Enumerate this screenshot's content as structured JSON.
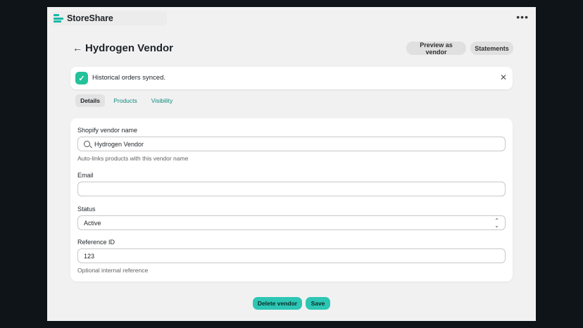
{
  "app": {
    "name": "StoreShare",
    "more_label": "•••"
  },
  "header": {
    "back_label": "←",
    "title": "Hydrogen Vendor",
    "preview_label": "Preview as vendor",
    "statements_label": "Statements"
  },
  "banner": {
    "check_glyph": "✓",
    "message": "Historical orders synced.",
    "close_glyph": "✕"
  },
  "tabs": [
    {
      "label": "Details",
      "selected": true
    },
    {
      "label": "Products",
      "selected": false
    },
    {
      "label": "Visibility",
      "selected": false
    }
  ],
  "form": {
    "vendor_name": {
      "label": "Shopify vendor name",
      "value": "Hydrogen Vendor",
      "help": "Auto-links products with this vendor name"
    },
    "email": {
      "label": "Email",
      "value": ""
    },
    "status": {
      "label": "Status",
      "value": "Active"
    },
    "reference": {
      "label": "Reference ID",
      "value": "123",
      "help": "Optional internal reference"
    }
  },
  "footer": {
    "delete_label": "Delete vendor",
    "save_label": "Save"
  },
  "colors": {
    "accent": "#2dc6b4",
    "brand": "#16b8a6",
    "success": "#23c29a",
    "link": "#0e8a7e"
  }
}
